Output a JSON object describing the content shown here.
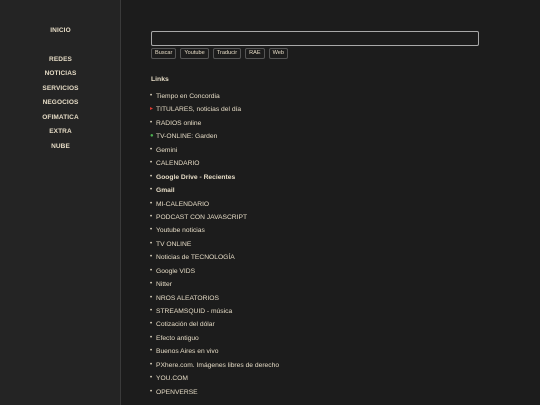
{
  "sidebar": {
    "items": [
      {
        "label": "INICIO"
      },
      {
        "label": "REDES"
      },
      {
        "label": "NOTICIAS"
      },
      {
        "label": "SERVICIOS"
      },
      {
        "label": "NEGOCIOS"
      },
      {
        "label": "OFIMATICA"
      },
      {
        "label": "EXTRA"
      },
      {
        "label": "NUBE"
      }
    ]
  },
  "search": {
    "value": "",
    "placeholder": "",
    "buttons": [
      "Buscar",
      "Youtube",
      "Traducir",
      "RAE",
      "Web"
    ]
  },
  "links": {
    "title": "Links",
    "items": [
      {
        "label": "Tiempo en Concordia",
        "bullet": "disc"
      },
      {
        "label": "TITULARES, noticias del día",
        "bullet": "red-triangle"
      },
      {
        "label": "RADIOS online",
        "bullet": "disc"
      },
      {
        "label": "TV-ONLINE: Garden",
        "bullet": "green-dot"
      },
      {
        "label": "Gemini",
        "bullet": "disc"
      },
      {
        "label": "CALENDARIO",
        "bullet": "disc"
      },
      {
        "label": "Google Drive - Recientes",
        "bullet": "disc",
        "bold": true
      },
      {
        "label": "Gmail",
        "bullet": "disc",
        "bold": true
      },
      {
        "label": "MI-CALENDARIO",
        "bullet": "disc"
      },
      {
        "label": "PODCAST CON JAVASCRIPT",
        "bullet": "disc"
      },
      {
        "label": "Youtube noticias",
        "bullet": "disc"
      },
      {
        "label": "TV ONLINE",
        "bullet": "disc"
      },
      {
        "label": "Noticias de TECNOLOGÍA",
        "bullet": "disc"
      },
      {
        "label": "Google VIDS",
        "bullet": "disc"
      },
      {
        "label": "Nitter",
        "bullet": "disc"
      },
      {
        "label": "NROS ALEATORIOS",
        "bullet": "disc"
      },
      {
        "label": "STREAMSQUID - música",
        "bullet": "disc"
      },
      {
        "label": "Cotización del dólar",
        "bullet": "disc"
      },
      {
        "label": "Efecto antiguo",
        "bullet": "disc"
      },
      {
        "label": "Buenos Aires en vivo",
        "bullet": "disc"
      },
      {
        "label": "PXhere.com. Imágenes libres de derecho",
        "bullet": "disc"
      },
      {
        "label": "YOU.COM",
        "bullet": "disc"
      },
      {
        "label": "OPENVERSE",
        "bullet": "disc"
      }
    ]
  },
  "colors": {
    "background": "#1c1c1c",
    "sidebar_background": "#242424",
    "text": "#e6dcc6",
    "red_bullet": "#e03c32",
    "green_bullet": "#4caf50"
  }
}
